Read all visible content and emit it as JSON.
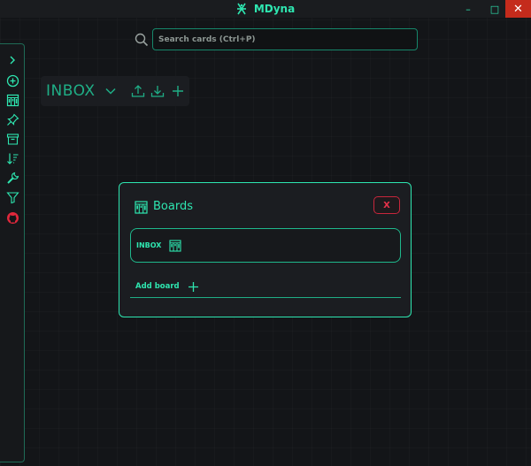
{
  "window": {
    "title": "MDyna",
    "minimize": "–",
    "maximize": "□",
    "close": "✕"
  },
  "search": {
    "placeholder": "Search cards (Ctrl+P)",
    "value": ""
  },
  "sidebar": {
    "items": [
      {
        "icon": "chevron-right-icon"
      },
      {
        "icon": "add-circle-icon"
      },
      {
        "icon": "boards-icon"
      },
      {
        "icon": "pin-icon"
      },
      {
        "icon": "archive-icon"
      },
      {
        "icon": "sort-icon"
      },
      {
        "icon": "wrench-icon"
      },
      {
        "icon": "filter-icon"
      },
      {
        "icon": "github-icon"
      }
    ]
  },
  "board_header": {
    "title": "INBOX",
    "actions": [
      "chevron-down-icon",
      "upload-icon",
      "download-icon",
      "plus-icon"
    ]
  },
  "boards_modal": {
    "title": "Boards",
    "close_label": "X",
    "boards": [
      {
        "name": "INBOX"
      }
    ],
    "add_board_label": "Add board"
  },
  "colors": {
    "accent": "#2ee6b0",
    "background": "#131518",
    "panel": "#1b1d21",
    "danger": "#e8324b",
    "github": "#e0283c"
  }
}
